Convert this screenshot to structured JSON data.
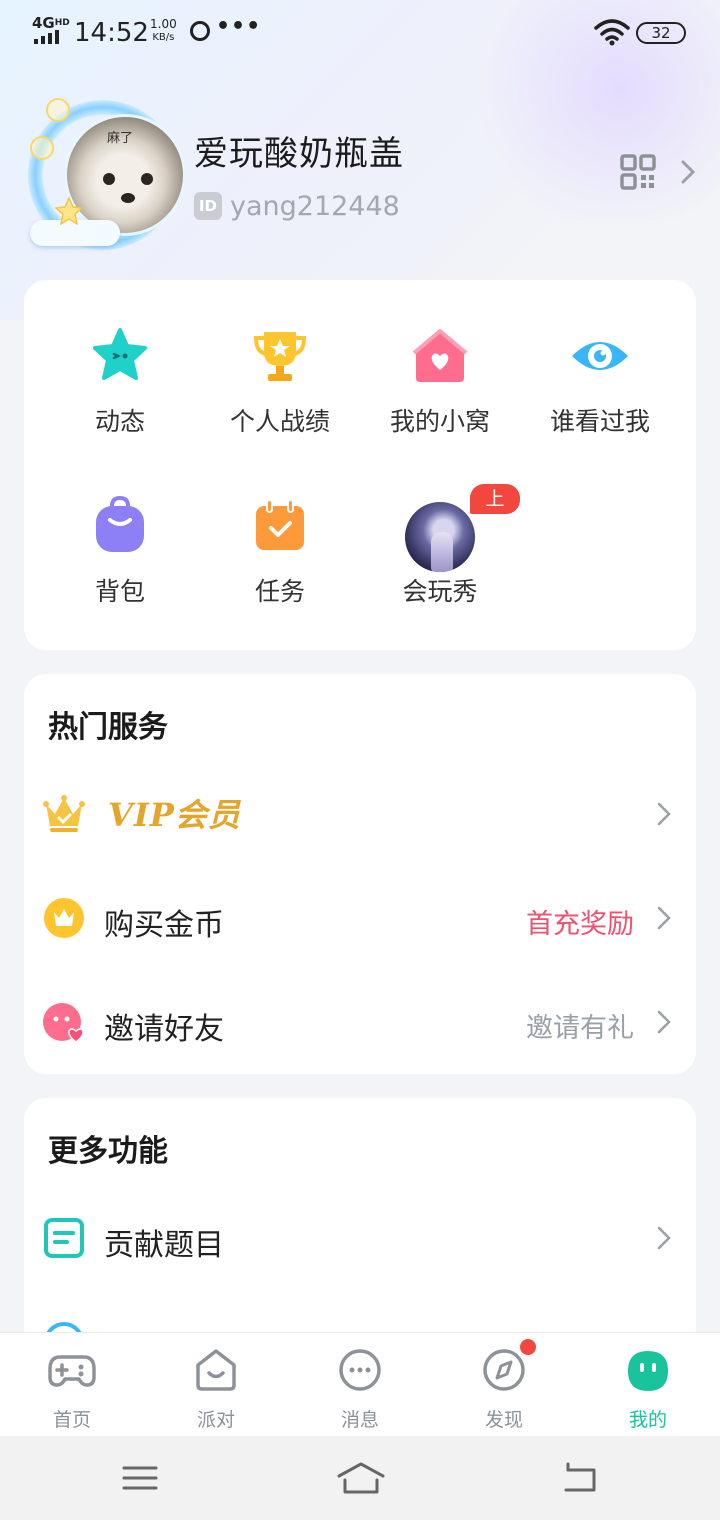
{
  "status_bar": {
    "network": "4G",
    "network_sup": "HD",
    "time": "14:52",
    "speed_value": "1.00",
    "speed_unit": "KB/s",
    "more": "•••",
    "battery": "32"
  },
  "profile": {
    "avatar_caption": "麻了",
    "username": "爱玩酸奶瓶盖",
    "id_badge": "ID",
    "id_value": "yang212448"
  },
  "grid": {
    "items": [
      {
        "label": "动态",
        "icon": "star-icon",
        "color": "#1fd1c9"
      },
      {
        "label": "个人战绩",
        "icon": "trophy-icon",
        "color": "#ffc52e"
      },
      {
        "label": "我的小窝",
        "icon": "house-icon",
        "color": "#ff6d8e"
      },
      {
        "label": "谁看过我",
        "icon": "eye-icon",
        "color": "#39b6f7"
      },
      {
        "label": "背包",
        "icon": "backpack-icon",
        "color": "#8d7ff5"
      },
      {
        "label": "任务",
        "icon": "calendar-check-icon",
        "color": "#ff9a3b"
      },
      {
        "label": "会玩秀",
        "icon": "show-thumbnail",
        "badge": "上新"
      }
    ]
  },
  "hot_services": {
    "title": "热门服务",
    "vip_label": "VIP会员",
    "rows": [
      {
        "label": "购买金币",
        "right": "首充奖励"
      },
      {
        "label": "邀请好友",
        "right": "邀请有礼"
      }
    ]
  },
  "more_features": {
    "title": "更多功能",
    "rows": [
      {
        "label": "贡献题目"
      }
    ]
  },
  "bottom_nav": {
    "items": [
      {
        "label": "首页",
        "icon": "gamepad-icon"
      },
      {
        "label": "派对",
        "icon": "party-icon"
      },
      {
        "label": "消息",
        "icon": "chat-icon"
      },
      {
        "label": "发现",
        "icon": "compass-icon"
      },
      {
        "label": "我的",
        "icon": "me-icon"
      }
    ],
    "active": "我的"
  },
  "colors": {
    "accent": "#19c39b",
    "hot_text": "#f0506e",
    "badge_red": "#f2473f",
    "vip_gold": "#e3a52a"
  }
}
